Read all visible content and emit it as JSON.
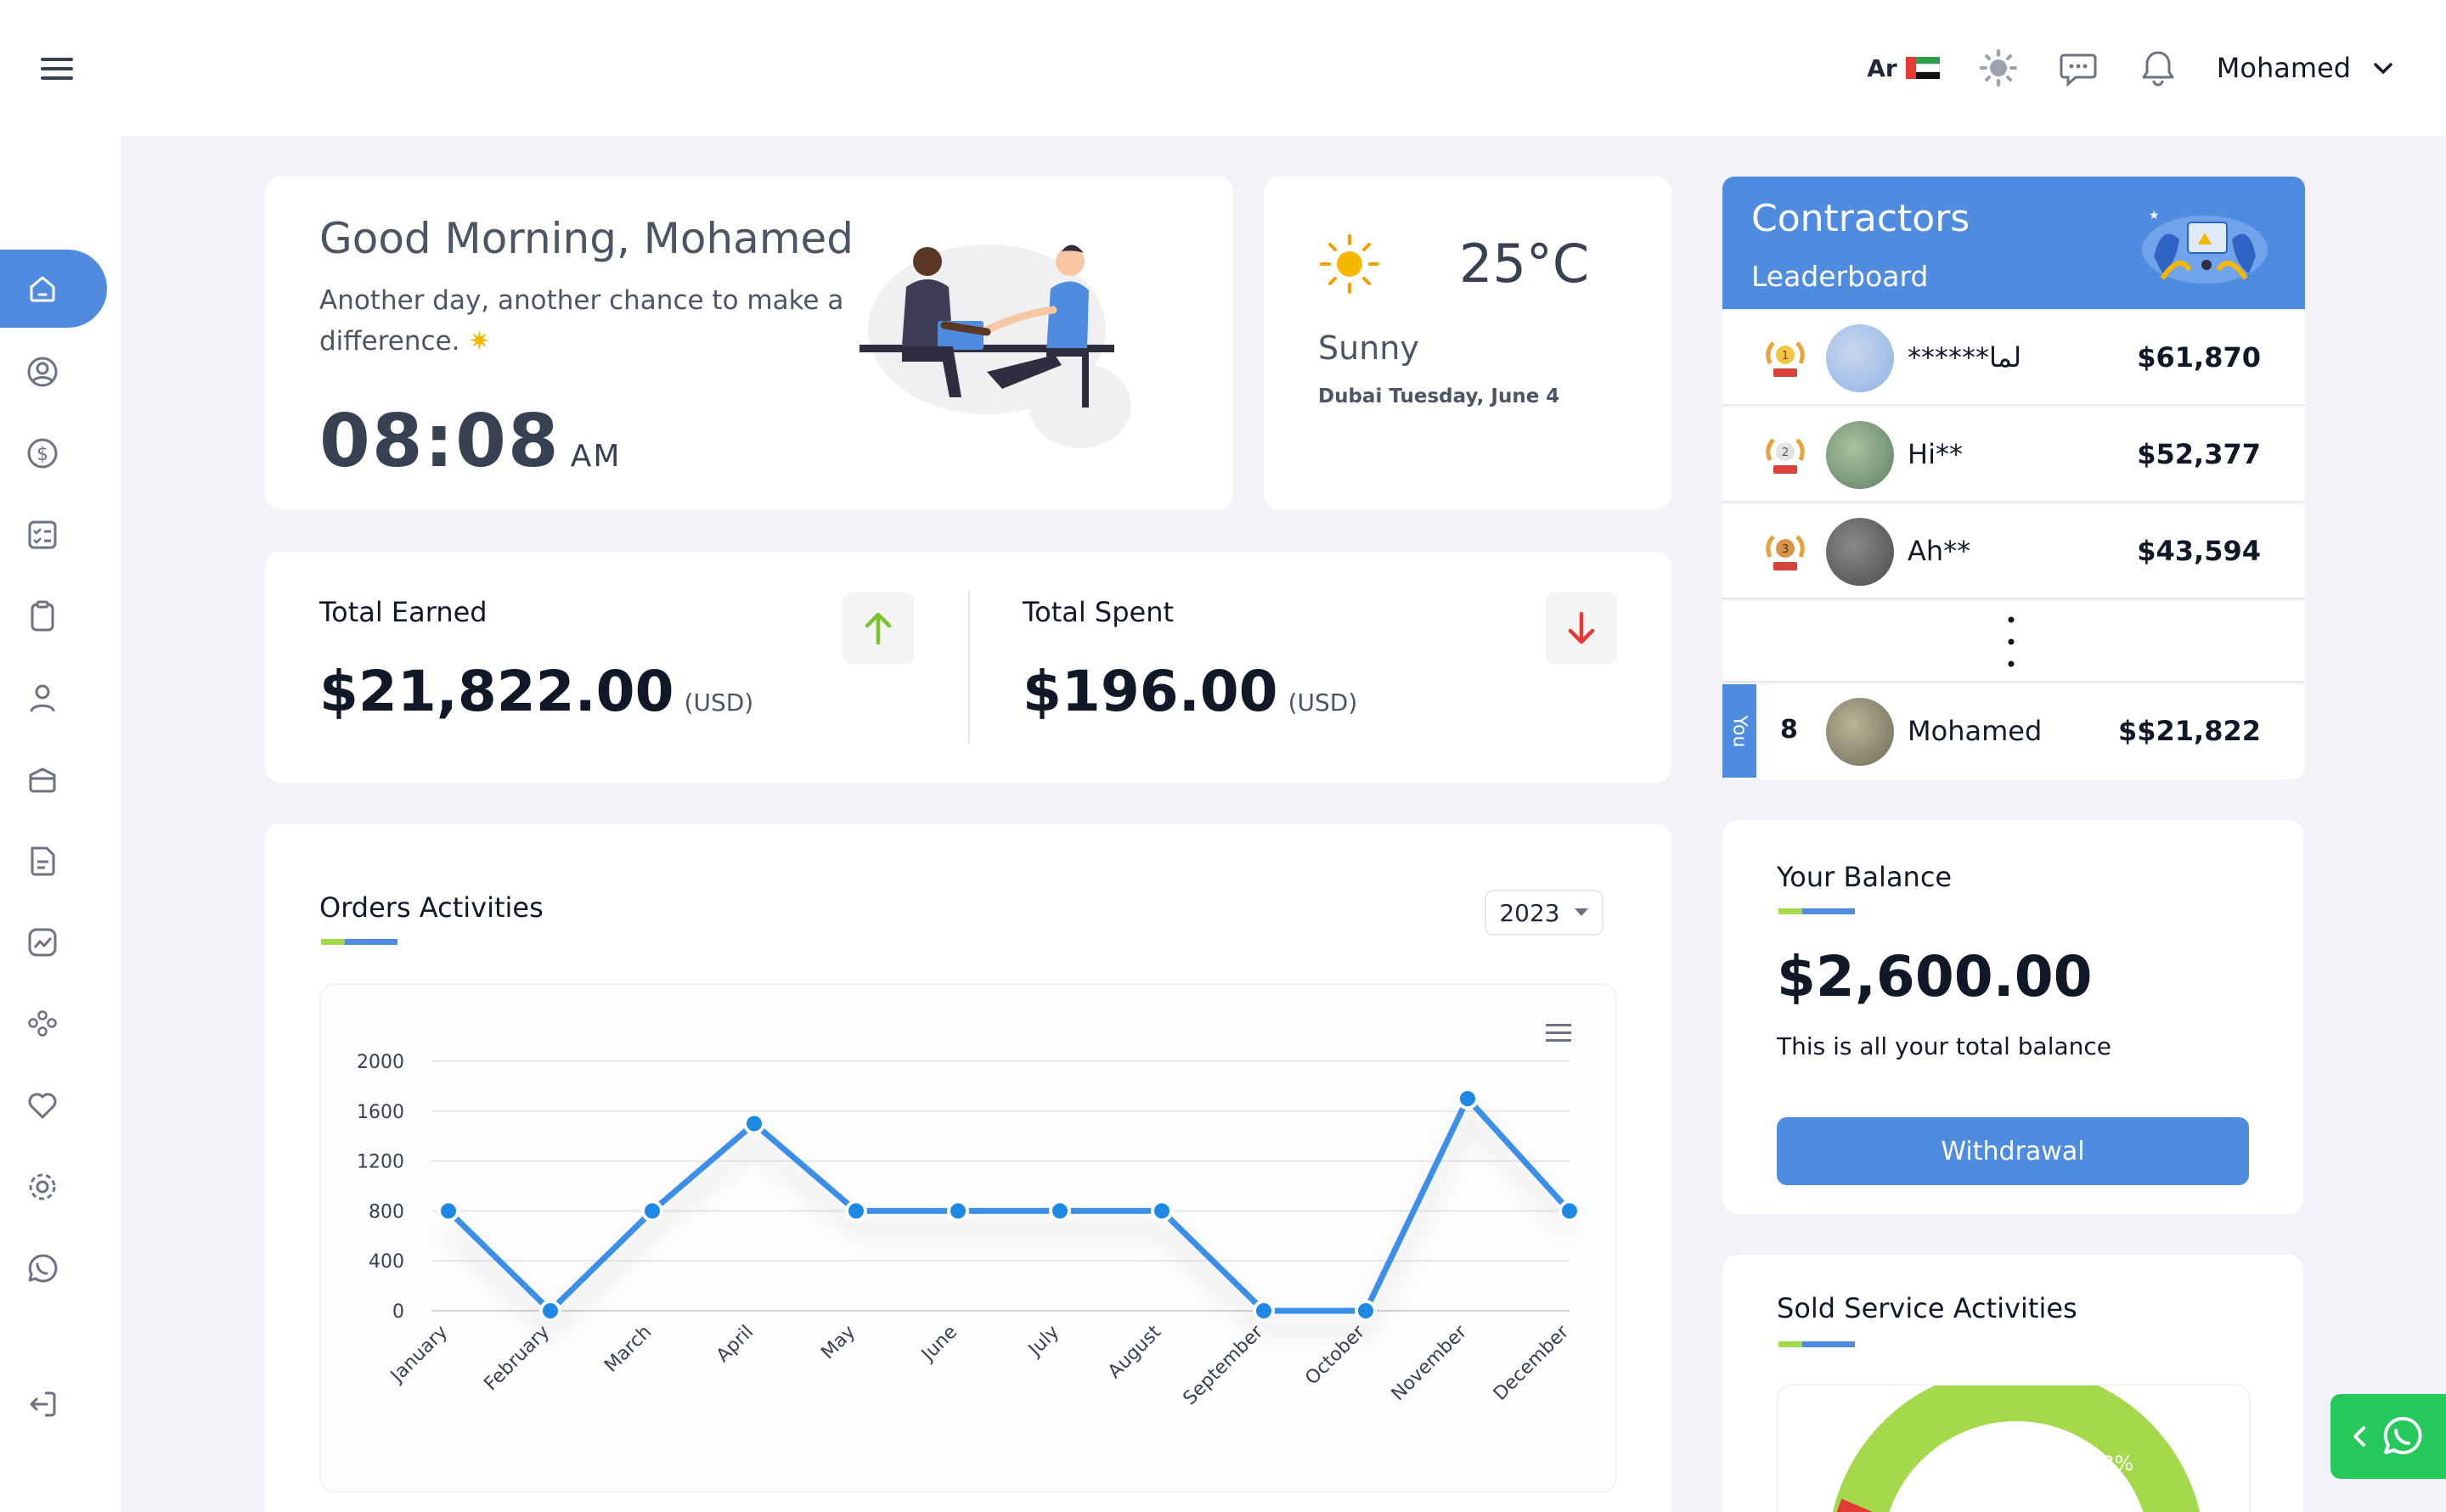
{
  "topbar": {
    "lang_label": "Ar",
    "user_name": "Mohamed"
  },
  "greeting": {
    "title": "Good Morning, Mohamed",
    "subtitle": "Another day, another chance to make a difference.",
    "time": "08:08",
    "ampm": "AM"
  },
  "weather": {
    "temp": "25°C",
    "condition": "Sunny",
    "location_date": "Dubai Tuesday, June 4"
  },
  "stats": {
    "earned_label": "Total Earned",
    "earned_value": "$21,822.00",
    "earned_unit": "(USD)",
    "spent_label": "Total Spent",
    "spent_value": "$196.00",
    "spent_unit": "(USD)"
  },
  "orders": {
    "title": "Orders Activities",
    "year": "2023"
  },
  "chart_data": {
    "type": "line",
    "categories": [
      "January",
      "February",
      "March",
      "April",
      "May",
      "June",
      "July",
      "August",
      "September",
      "October",
      "November",
      "December"
    ],
    "values": [
      800,
      0,
      800,
      1500,
      800,
      800,
      800,
      800,
      0,
      0,
      1700,
      800
    ],
    "y_ticks": [
      "0",
      "400",
      "800",
      "1200",
      "1600",
      "2000"
    ],
    "ylim": [
      0,
      2000
    ],
    "grid": true,
    "color": "#3b8fe8"
  },
  "leaderboard": {
    "title": "Contractors",
    "subtitle": "Leaderboard",
    "rows": [
      {
        "name": "******لما",
        "amount": "$61,870"
      },
      {
        "name": "Hi**",
        "amount": "$52,377"
      },
      {
        "name": "Ah**",
        "amount": "$43,594"
      }
    ],
    "you_label": "You",
    "you_rank": "8",
    "you_name": "Mohamed",
    "you_amount": "$$21,822"
  },
  "balance": {
    "title": "Your Balance",
    "value": "$2,600.00",
    "note": "This is all your total balance",
    "button": "Withdrawal"
  },
  "sold": {
    "title": "Sold Service Activities",
    "percent_label": "77.8%"
  }
}
